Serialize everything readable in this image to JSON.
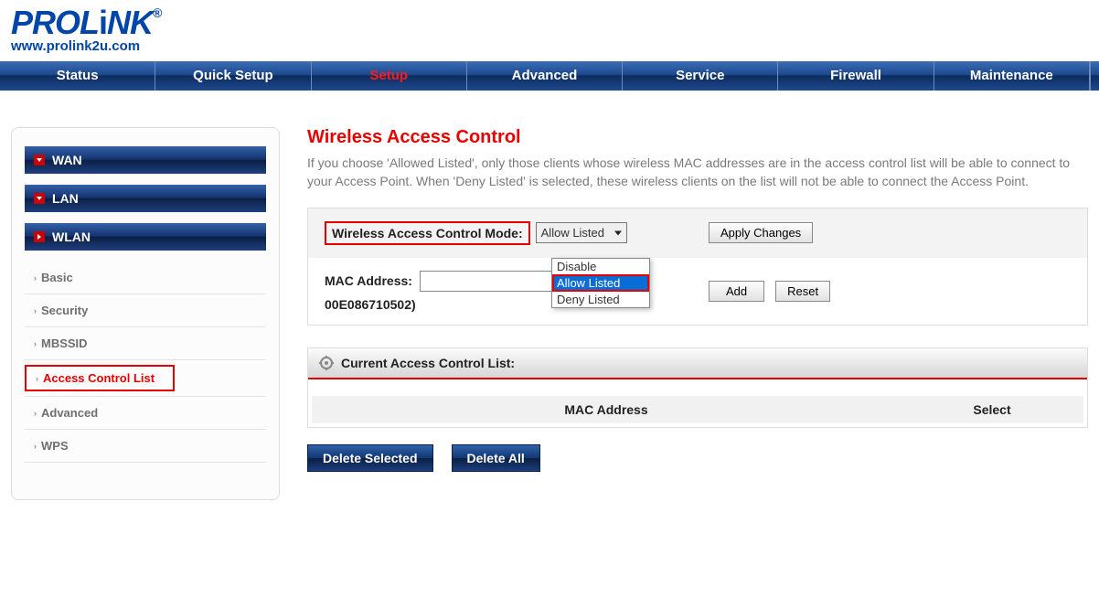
{
  "brand": {
    "name": "PROLiNK",
    "reg": "®",
    "url": "www.prolink2u.com"
  },
  "nav": {
    "items": [
      "Status",
      "Quick Setup",
      "Setup",
      "Advanced",
      "Service",
      "Firewall",
      "Maintenance"
    ],
    "active_index": 2
  },
  "sidebar": {
    "main": [
      "WAN",
      "LAN",
      "WLAN"
    ],
    "expanded_index": 2,
    "sub": [
      "Basic",
      "Security",
      "MBSSID",
      "Access Control List",
      "Advanced",
      "WPS"
    ],
    "selected_sub_index": 3
  },
  "page": {
    "title": "Wireless Access Control",
    "desc": "If you choose 'Allowed Listed', only those clients whose wireless MAC addresses are in the access control list will be able to connect to your Access Point. When 'Deny Listed' is selected, these wireless clients on the list will not be able to connect the Access Point."
  },
  "form": {
    "mode_label": "Wireless Access Control Mode:",
    "mode_selected": "Allow Listed",
    "mode_options": [
      "Disable",
      "Allow Listed",
      "Deny Listed"
    ],
    "apply_btn": "Apply Changes",
    "mac_label": "MAC Address:",
    "mac_hint": "00E086710502)",
    "mac_value": "",
    "add_btn": "Add",
    "reset_btn": "Reset"
  },
  "acl": {
    "title": "Current Access Control List:",
    "cols": {
      "mac": "MAC Address",
      "select": "Select"
    }
  },
  "actions": {
    "del_sel": "Delete Selected",
    "del_all": "Delete All"
  }
}
